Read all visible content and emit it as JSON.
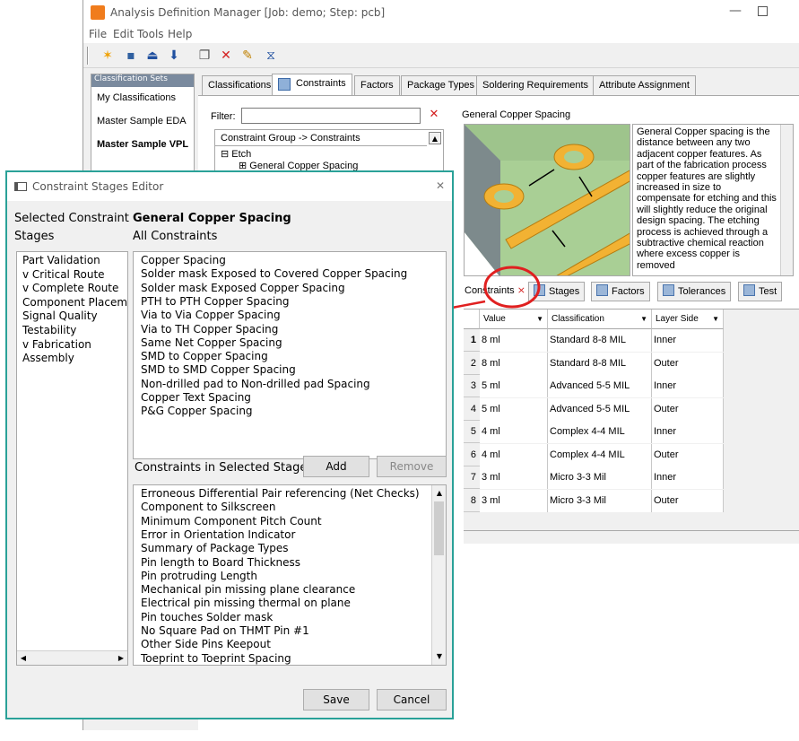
{
  "main_window": {
    "title": "Analysis Definition Manager [Job: demo; Step: pcb]",
    "min_glyph": "—",
    "menu": [
      "File",
      "Edit",
      "Tools",
      "Help"
    ],
    "classification_sets": {
      "header": "Classification Sets",
      "items": [
        "My Classifications",
        "Master Sample EDA",
        "Master Sample VPL"
      ]
    },
    "tabs": [
      "Classifications",
      "Constraints",
      "Factors",
      "Package Types",
      "Soldering Requirements",
      "Attribute Assignment"
    ],
    "filter_label": "Filter:",
    "tree": {
      "header": "Constraint Group -> Constraints",
      "items": [
        "Etch",
        "General Copper Spacing"
      ]
    },
    "detail_title": "General Copper Spacing",
    "description": "General Copper spacing is the distance between any two adjacent copper features. As part of the fabrication process copper features are slightly increased in size to compensate for etching and this will slightly reduce the original design spacing. The etching process is achieved through a subtractive chemical reaction where excess copper is removed",
    "lower_tabs": [
      "Constraints",
      "Stages",
      "Factors",
      "Tolerances",
      "Test"
    ],
    "grid": {
      "columns": [
        "Value",
        "Classification",
        "Layer Side"
      ],
      "rows": [
        {
          "num": "1",
          "value": "8 ml",
          "classification": "Standard 8-8 MIL",
          "side": "Inner"
        },
        {
          "num": "2",
          "value": "8 ml",
          "classification": "Standard 8-8 MIL",
          "side": "Outer"
        },
        {
          "num": "3",
          "value": "5 ml",
          "classification": "Advanced 5-5 MIL",
          "side": "Inner"
        },
        {
          "num": "4",
          "value": "5 ml",
          "classification": "Advanced 5-5 MIL",
          "side": "Outer"
        },
        {
          "num": "5",
          "value": "4 ml",
          "classification": "Complex 4-4 MIL",
          "side": "Inner"
        },
        {
          "num": "6",
          "value": "4 ml",
          "classification": "Complex 4-4 MIL",
          "side": "Outer"
        },
        {
          "num": "7",
          "value": "3 ml",
          "classification": "Micro 3-3 Mil",
          "side": "Inner"
        },
        {
          "num": "8",
          "value": "3 ml",
          "classification": "Micro 3-3 Mil",
          "side": "Outer"
        }
      ]
    }
  },
  "dialog": {
    "title": "Constraint Stages Editor",
    "close_glyph": "✕",
    "selected_label_1": "Selected Constraint",
    "selected_label_2": "Stages",
    "constraint_name": "General Copper Spacing",
    "all_label": "All Constraints",
    "stages": [
      "Part Validation",
      "v Critical Route",
      "v Complete Route",
      "Component Placeme",
      "Signal Quality",
      "Testability",
      "v Fabrication",
      "Assembly"
    ],
    "all_constraints": [
      "Copper Spacing",
      "Solder mask Exposed to Covered Copper Spacing",
      "Solder mask Exposed Copper Spacing",
      "PTH to PTH Copper Spacing",
      "Via to Via Copper Spacing",
      "Via to TH Copper Spacing",
      "Same Net Copper Spacing",
      "SMD to Copper Spacing",
      "SMD to SMD Copper Spacing",
      "Non-drilled pad to Non-drilled pad Spacing",
      "Copper Text Spacing",
      "P&G Copper Spacing"
    ],
    "in_stage_label": "Constraints in Selected Stage",
    "add_label": "Add",
    "remove_label": "Remove",
    "stage_constraints": [
      "Erroneous Differential Pair referencing (Net Checks)",
      "Component to Silkscreen",
      "Minimum Component Pitch Count",
      "Error in Orientation Indicator",
      "Summary of Package Types",
      "Pin length to Board Thickness",
      "Pin protruding Length",
      "Mechanical pin missing plane clearance",
      "Electrical pin missing thermal on plane",
      "Pin touches Solder mask",
      "No Square Pad on THMT Pin #1",
      "Other Side Pins Keepout",
      "Toeprint to Toeprint Spacing"
    ],
    "save_label": "Save",
    "cancel_label": "Cancel"
  },
  "colors": {
    "dialog_border": "#2aa198",
    "annotation": "#e02020"
  }
}
